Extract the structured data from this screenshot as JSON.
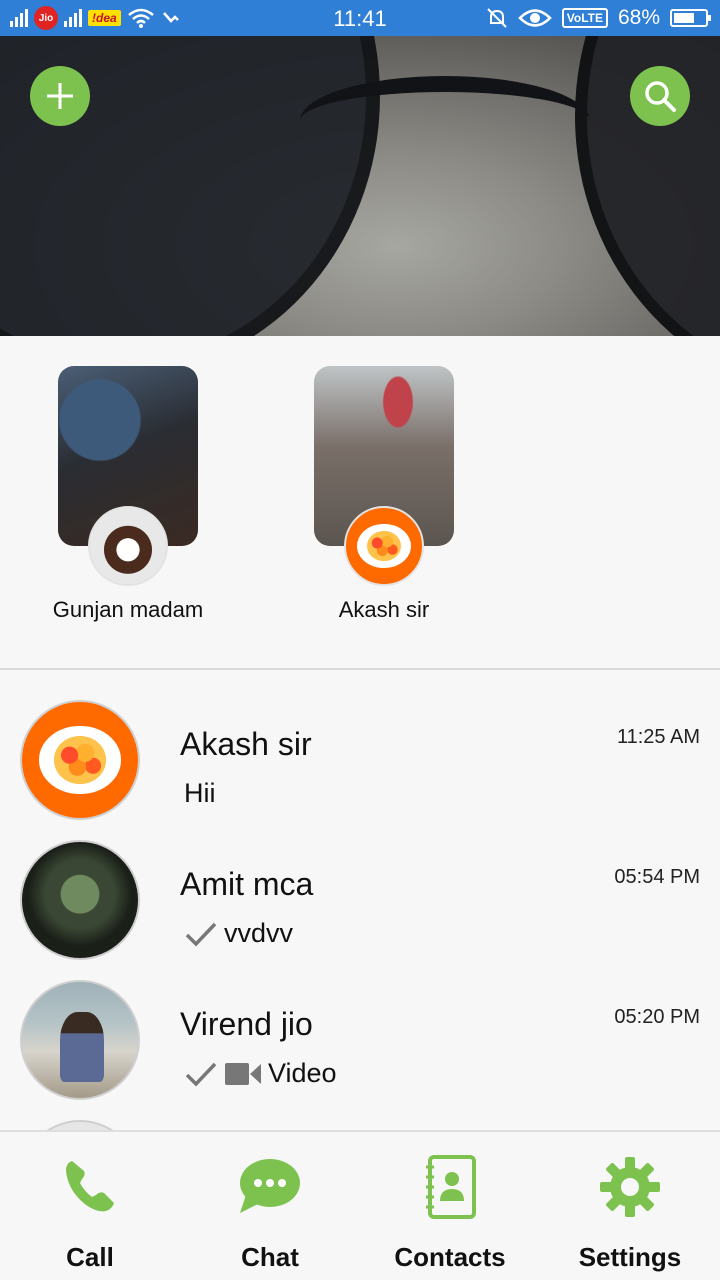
{
  "status_bar": {
    "carrier1": "Jio",
    "carrier2": "!dea",
    "time": "11:41",
    "volte": "VoLTE",
    "battery_percent": "68%",
    "battery_level": 0.68
  },
  "header": {
    "add_icon": "plus-icon",
    "search_icon": "search-icon"
  },
  "stories": [
    {
      "name": "Gunjan madam"
    },
    {
      "name": "Akash sir"
    }
  ],
  "chats": [
    {
      "name": "Akash sir",
      "time": "11:25 AM",
      "message": "Hii"
    },
    {
      "name": "Amit mca",
      "time": "05:54 PM",
      "message": "vvdvv"
    },
    {
      "name": "Virend jio",
      "time": "05:20 PM",
      "message": "Video"
    }
  ],
  "nav": {
    "call": "Call",
    "chat": "Chat",
    "contacts": "Contacts",
    "settings": "Settings"
  },
  "colors": {
    "accent": "#7dc24f",
    "status_bar": "#2f7fd6",
    "brand_orange": "#ff6a00"
  }
}
